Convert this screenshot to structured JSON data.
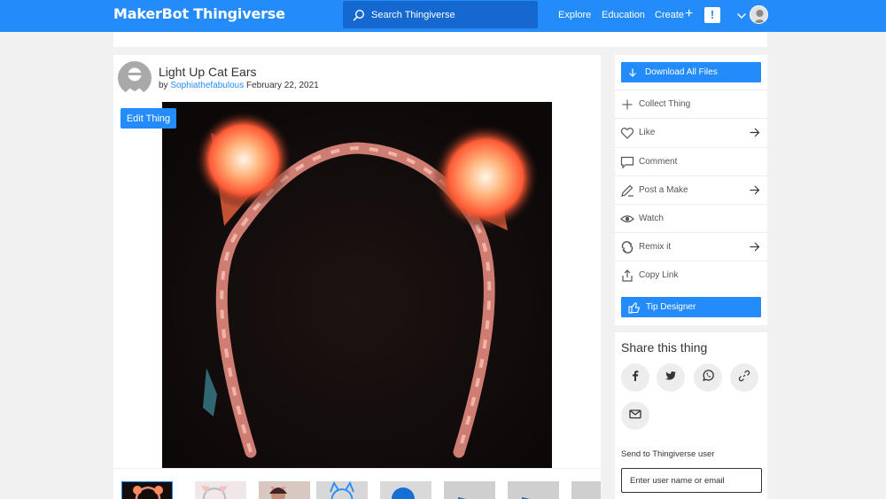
{
  "header": {
    "logo_part1": "MakerBot",
    "logo_part2": "Thingiverse",
    "search_placeholder": "Search Thingiverse",
    "nav": [
      "Explore",
      "Education",
      "Create"
    ],
    "notifications_badge": "!",
    "brand_color": "#248bfb"
  },
  "thing": {
    "title": "Light Up Cat Ears",
    "by_prefix": "by",
    "author": "Sophiathefabulous",
    "date": "February 22, 2021",
    "edit_button": "Edit Thing"
  },
  "actions": {
    "download": "Download All Files",
    "items": [
      {
        "label": "Collect Thing",
        "icon": "plus-icon",
        "has_arrow": false
      },
      {
        "label": "Like",
        "icon": "heart-icon",
        "has_arrow": true
      },
      {
        "label": "Comment",
        "icon": "comment-icon",
        "has_arrow": false
      },
      {
        "label": "Post a Make",
        "icon": "pencil-icon",
        "has_arrow": true
      },
      {
        "label": "Watch",
        "icon": "eye-icon",
        "has_arrow": false
      },
      {
        "label": "Remix it",
        "icon": "remix-icon",
        "has_arrow": true
      },
      {
        "label": "Copy Link",
        "icon": "share-icon",
        "has_arrow": false
      }
    ],
    "tip": "Tip Designer"
  },
  "share": {
    "title": "Share this thing",
    "networks": [
      "facebook-icon",
      "twitter-icon",
      "whatsapp-icon",
      "link-icon",
      "email-icon"
    ],
    "send_label": "Send to Thingiverse user",
    "input_placeholder": "Enter user name or email"
  }
}
